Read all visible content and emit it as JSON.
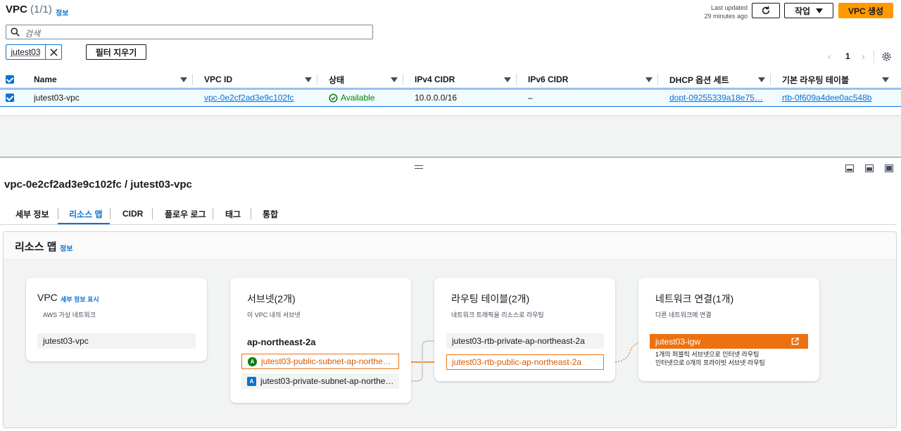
{
  "header": {
    "title": "VPC",
    "count": "(1/1)",
    "info": "정보",
    "last_updated_1": "Last updated",
    "last_updated_2": "29 minutes ago",
    "actions_label": "작업",
    "create_label": "VPC 생성"
  },
  "search": {
    "placeholder": "검색"
  },
  "filter": {
    "token": "jutest03",
    "clear_label": "필터 지우기"
  },
  "pagination": {
    "page": "1"
  },
  "table": {
    "columns": [
      "Name",
      "VPC ID",
      "상태",
      "IPv4 CIDR",
      "IPv6 CIDR",
      "DHCP 옵션 세트",
      "기본 라우팅 테이블"
    ],
    "rows": [
      {
        "name": "jutest03-vpc",
        "vpc_id": "vpc-0e2cf2ad3e9c102fc",
        "status": "Available",
        "ipv4": "10.0.0.0/16",
        "ipv6": "–",
        "dhcp": "dopt-09255339a18e75…",
        "rtb": "rtb-0f609a4dee0ac548b"
      }
    ]
  },
  "detail": {
    "title": "vpc-0e2cf2ad3e9c102fc / jutest03-vpc",
    "tabs": [
      "세부 정보",
      "리소스 맵",
      "CIDR",
      "플로우 로그",
      "태그",
      "통합"
    ],
    "active_tab": "리소스 맵"
  },
  "resource_map": {
    "title": "리소스 맵",
    "info": "정보",
    "vpc": {
      "title": "VPC",
      "details_link": "세부 정보 표시",
      "sub": "AWS 가상 네트워크",
      "item": "jutest03-vpc"
    },
    "subnets": {
      "title": "서브넷(2개)",
      "sub": "이 VPC 내의 서브넷",
      "az": "ap-northeast-2a",
      "public": "jutest03-public-subnet-ap-northe…",
      "private": "jutest03-private-subnet-ap-northe…"
    },
    "route_tables": {
      "title": "라우팅 테이블(2개)",
      "sub": "네트워크 트래픽을 리소스로 라우팅",
      "private": "jutest03-rtb-private-ap-northeast-2a",
      "public": "jutest03-rtb-public-ap-northeast-2a"
    },
    "network": {
      "title": "네트워크 연결(1개)",
      "sub": "다른 네트워크에 연결",
      "igw": "jutest03-igw",
      "note_1": "1개의 퍼블릭 서브넷으로 인터넷 라우팅",
      "note_2": "인터넷으로 0개의 프라이빗 서브넷 라우팅"
    }
  },
  "colors": {
    "accent": "#ff9900",
    "link": "#0972d3",
    "orange": "#ec7211",
    "success": "#037f0c"
  }
}
